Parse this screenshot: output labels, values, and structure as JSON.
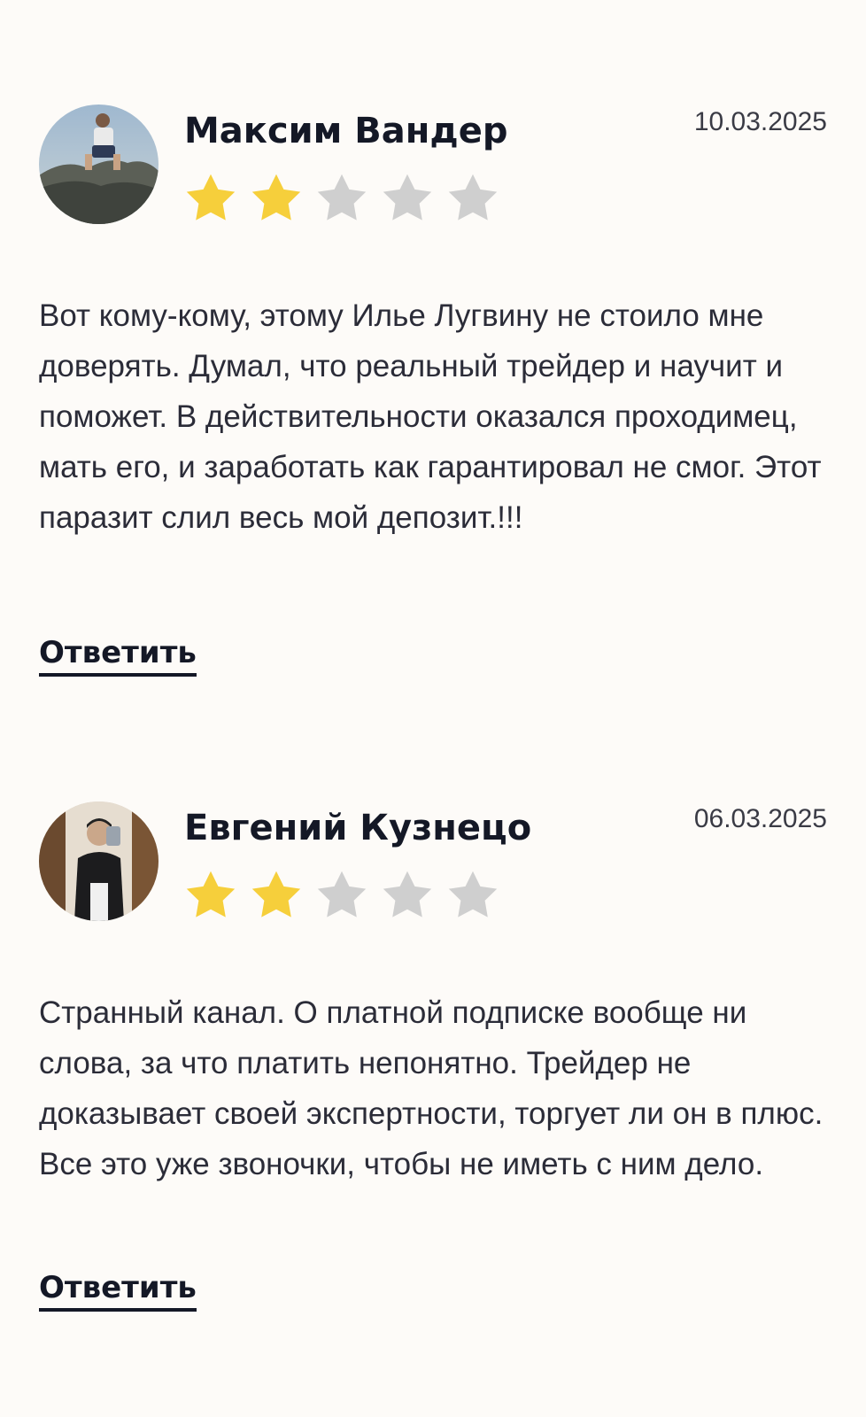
{
  "colors": {
    "background": "#fdfbf8",
    "star_filled": "#f6cf3b",
    "star_empty": "#cfcfcf",
    "text_dark": "#141826"
  },
  "reviews": [
    {
      "author": "Максим Вандер",
      "date": "10.03.2025",
      "rating": 2,
      "max_rating": 5,
      "text": "Вот кому-кому, этому Илье Лугвину не стоило мне доверять. Думал, что реальный трейдер и научит и поможет. В действительности оказался проходимец, мать его, и заработать как гарантировал не смог. Этот паразит слил весь мой депозит.!!!",
      "reply_label": "Ответить"
    },
    {
      "author": "Евгений Кузнецо",
      "date": "06.03.2025",
      "rating": 2,
      "max_rating": 5,
      "text": "Странный канал. О платной подписке вообще ни слова, за что платить непонятно. Трейдер не доказывает своей экспертности, торгует ли он в плюс. Все это уже звоночки, чтобы не иметь с ним дело.",
      "reply_label": "Ответить"
    }
  ]
}
